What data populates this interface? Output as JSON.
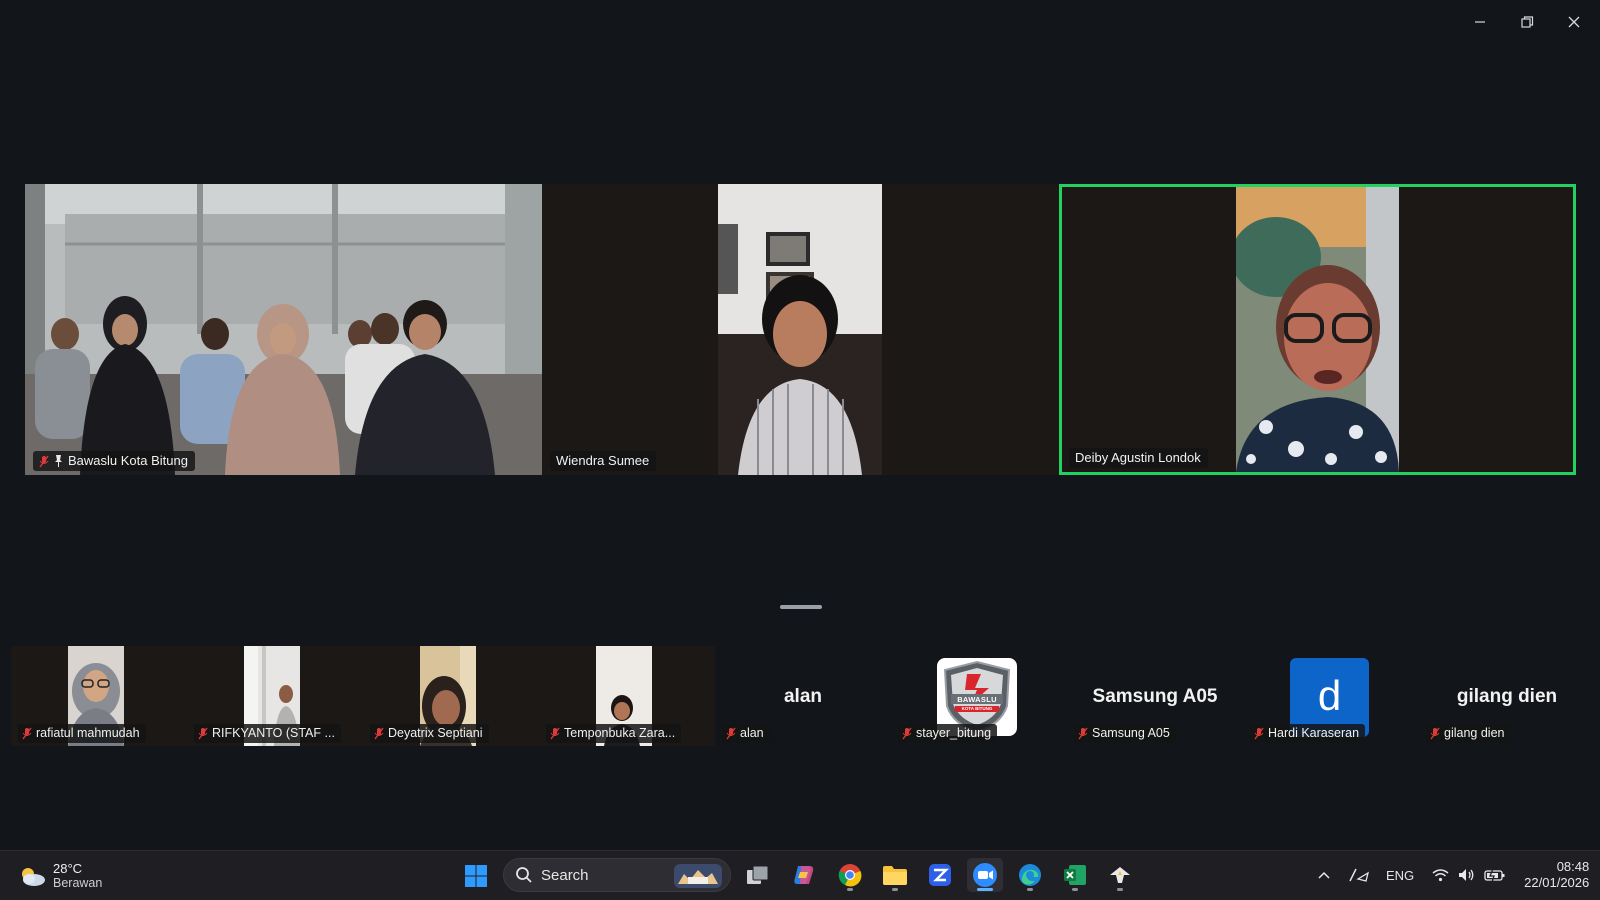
{
  "window": {
    "controls": [
      "minimize",
      "restore",
      "close"
    ]
  },
  "main_tiles": [
    {
      "name": "Bawaslu Kota Bitung",
      "muted": true,
      "pinned": true,
      "speaking": false
    },
    {
      "name": "Wiendra Sumee",
      "muted": false,
      "pinned": false,
      "speaking": false
    },
    {
      "name": "Deiby Agustin Londok",
      "muted": false,
      "pinned": false,
      "speaking": true
    }
  ],
  "gallery": [
    {
      "name": "rafiatul mahmudah",
      "muted": true,
      "display": "video"
    },
    {
      "name": "RIFKYANTO (STAF ...",
      "muted": true,
      "display": "video"
    },
    {
      "name": "Deyatrix Septiani",
      "muted": true,
      "display": "video"
    },
    {
      "name": "Temponbuka Zara...",
      "muted": true,
      "display": "video"
    },
    {
      "name": "alan",
      "muted": true,
      "display": "text",
      "big_label": "alan"
    },
    {
      "name": "stayer_bitung",
      "muted": true,
      "display": "logo",
      "logo_text": "BAWASLU",
      "logo_subtext": "KOTA BITUNG"
    },
    {
      "name": "Samsung A05",
      "muted": true,
      "display": "text",
      "big_label": "Samsung A05"
    },
    {
      "name": "Hardi Karaseran",
      "muted": true,
      "display": "avatar",
      "avatar_letter": "d"
    },
    {
      "name": "gilang dien",
      "muted": true,
      "display": "text",
      "big_label": "gilang dien"
    }
  ],
  "taskbar": {
    "weather": {
      "temp": "28°C",
      "condition": "Berawan"
    },
    "search_label": "Search",
    "language": "ENG",
    "time": "08:48",
    "date": "22/01/2026",
    "colors": {
      "windows_blue": "#2f9bff",
      "zoom_blue": "#2d8cff",
      "speaking_green": "#23d160",
      "avatar_blue": "#0e65c9"
    }
  }
}
